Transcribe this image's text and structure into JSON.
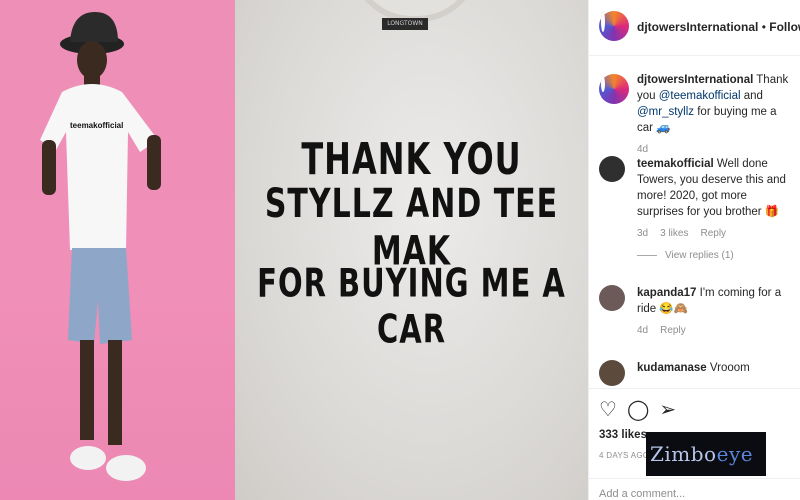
{
  "post": {
    "shirt_tag": "LONGTOWN",
    "shirt_text": [
      "THANK YOU",
      "STYLLZ AND TEE MAK",
      "FOR BUYING ME A CAR"
    ],
    "model_shirt_text": "teemakofficial"
  },
  "header": {
    "username": "djtowersInternational",
    "separator": " • ",
    "follow_label": "Following"
  },
  "caption": {
    "username": "djtowersInternational",
    "text_1": " Thank you ",
    "mention_1": "@teemakofficial",
    "text_2": " and ",
    "mention_2": "@mr_styllz",
    "text_3": " for buying me a car 🚙",
    "time": "4d"
  },
  "comments": [
    {
      "username": "teemakofficial",
      "text": " Well done Towers, you deserve this and more! 2020, got more surprises for you brother 🎁",
      "time": "3d",
      "likes": "3 likes",
      "reply_label": "Reply",
      "view_replies": "View replies (1)"
    },
    {
      "username": "kapanda17",
      "text": " I'm coming for a ride 😂🙈",
      "time": "4d",
      "reply_label": "Reply"
    },
    {
      "username": "kudamanase",
      "text": " Vrooom"
    }
  ],
  "actions": {
    "like_icon": "heart-icon",
    "comment_icon": "comment-icon",
    "share_icon": "share-icon",
    "likes": "333 likes",
    "ago": "4 DAYS AGO",
    "add_comment_placeholder": "Add a comment..."
  },
  "watermark": {
    "text_a": "Zimbo",
    "text_b": "eye"
  }
}
